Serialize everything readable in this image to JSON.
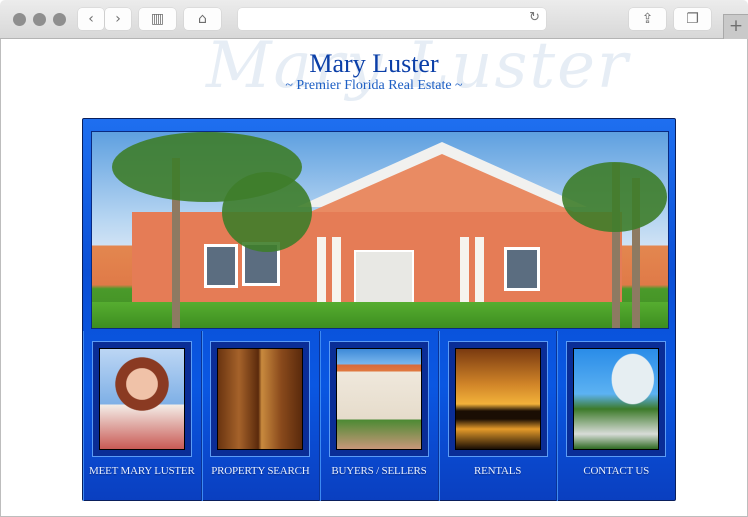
{
  "browser": {
    "back_icon": "‹",
    "forward_icon": "›",
    "sidebar_icon": "▥",
    "home_icon": "⌂",
    "reload_icon": "↻",
    "share_icon": "⇪",
    "tabs_icon": "❐",
    "new_tab_icon": "+",
    "url": ""
  },
  "header": {
    "watermark": "Mary Luster",
    "title": "Mary Luster",
    "subtitle": "~ Premier Florida Real Estate ~"
  },
  "hero": {
    "alt": "Coral stucco Florida home with palm trees"
  },
  "nav": {
    "items": [
      {
        "label": "MEET MARY LUSTER",
        "image": "portrait of Mary Luster"
      },
      {
        "label": "PROPERTY SEARCH",
        "image": "wooden front doors with brass handles"
      },
      {
        "label": "BUYERS / SELLERS",
        "image": "white Mediterranean-style house"
      },
      {
        "label": "RENTALS",
        "image": "family silhouette at sunset"
      },
      {
        "label": "CONTACT US",
        "image": "arched glass building with palms"
      }
    ]
  },
  "colors": {
    "title": "#0b3fa8",
    "subtitle": "#1d5fc4",
    "frame_blue": "#0b4fd6",
    "label_text": "#e8f0ff"
  }
}
